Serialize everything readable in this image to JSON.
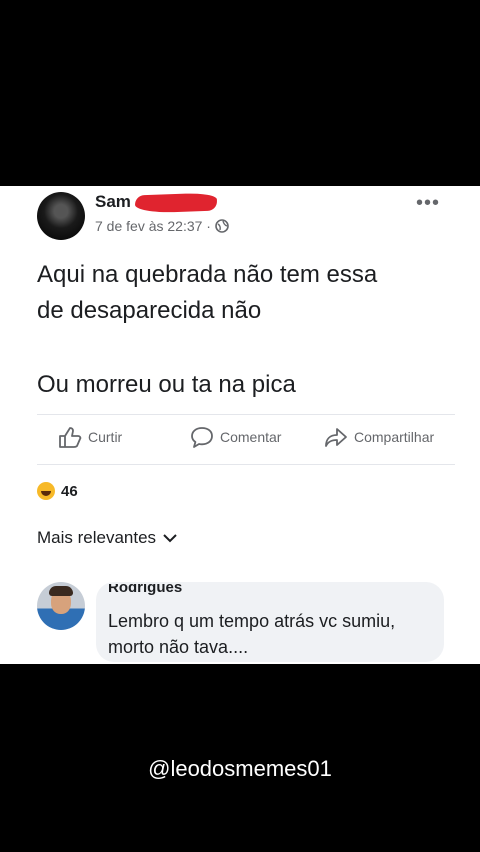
{
  "post": {
    "author": "Sam",
    "timestamp": "7 de fev às 22:37 ·",
    "text_line1": "Aqui na quebrada não tem essa",
    "text_line2": "de desaparecida não",
    "text_line3": "Ou morreu ou ta na pica",
    "reaction_count": "46"
  },
  "actions": {
    "like": "Curtir",
    "comment": "Comentar",
    "share": "Compartilhar"
  },
  "comments": {
    "sort_label": "Mais relevantes",
    "first": {
      "author_partial": "Rodrigues",
      "line1": "Lembro q um tempo atrás vc sumiu,",
      "line2": "morto não tava...."
    }
  },
  "watermark": "@leodosmemes01",
  "colors": {
    "text": "#1c1e21",
    "muted": "#65676b",
    "redaction": "#e0242f",
    "bubble": "#f0f2f5"
  },
  "icons": [
    "more-icon",
    "globe-icon",
    "like-icon",
    "comment-icon",
    "share-icon",
    "laugh-emoji-icon",
    "chevron-down-icon"
  ]
}
